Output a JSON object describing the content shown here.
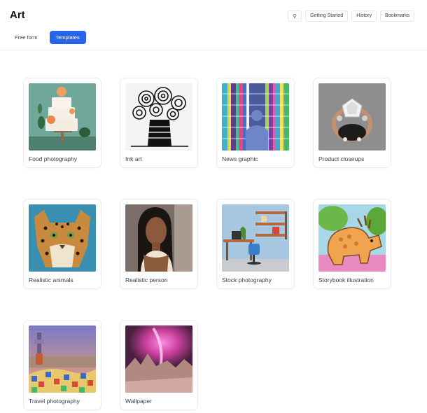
{
  "header": {
    "title": "Art",
    "tabs": [
      {
        "label": "Free form",
        "active": false
      },
      {
        "label": "Templates",
        "active": true
      }
    ],
    "toolbar": {
      "tips_icon": "lightbulb-icon",
      "getting_started": "Getting Started",
      "history": "History",
      "bookmarks": "Bookmarks"
    }
  },
  "accent_color": "#2563eb",
  "templates": [
    {
      "label": "Food photography"
    },
    {
      "label": "Ink art"
    },
    {
      "label": "News graphic"
    },
    {
      "label": "Product closeups"
    },
    {
      "label": "Realistic animals"
    },
    {
      "label": "Realistic person"
    },
    {
      "label": "Stock photography"
    },
    {
      "label": "Storybook illustration"
    },
    {
      "label": "Travel photography"
    },
    {
      "label": "Wallpaper"
    }
  ]
}
